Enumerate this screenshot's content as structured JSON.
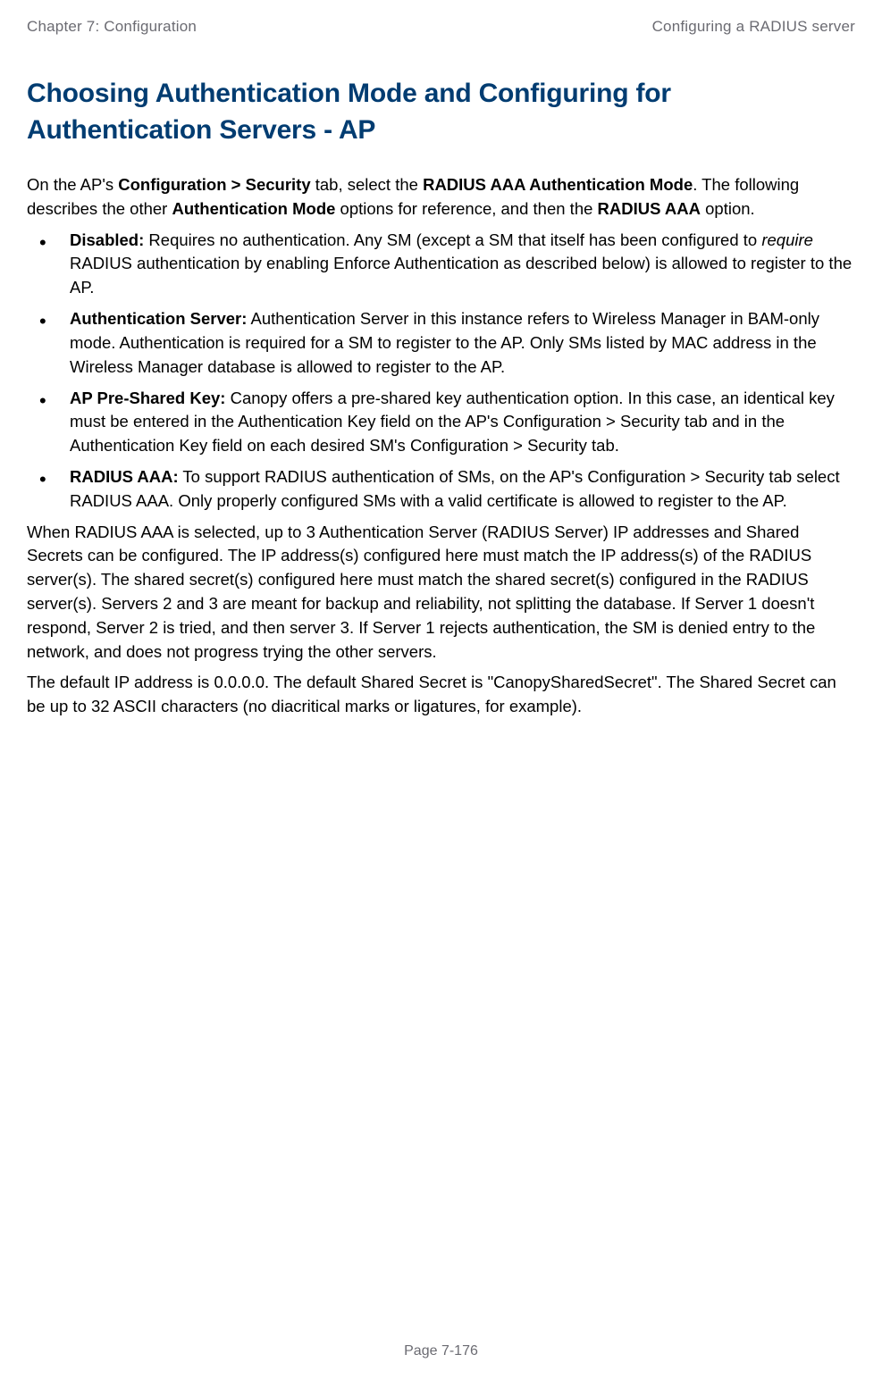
{
  "header": {
    "left": "Chapter 7:  Configuration",
    "right": "Configuring a RADIUS server"
  },
  "heading": "Choosing Authentication Mode and Configuring for Authentication Servers - AP",
  "intro": {
    "p1a": "On the AP's ",
    "p1b": "Configuration > Security",
    "p1c": " tab, select the ",
    "p1d": "RADIUS AAA Authentication Mode",
    "p1e": ". The following describes the other ",
    "p1f": "Authentication Mode",
    "p1g": " options for reference, and then the ",
    "p1h": "RADIUS AAA",
    "p1i": " option."
  },
  "bullets": {
    "b1_label": "Disabled:",
    "b1_texta": " Requires no authentication. Any SM (except a SM that itself has been configured to ",
    "b1_italic": "require",
    "b1_textb": " RADIUS authentication by enabling Enforce Authentication as described below) is allowed to register to the AP.",
    "b2_label": "Authentication Server:",
    "b2_text": " Authentication Server in this instance refers to Wireless Manager in BAM-only mode. Authentication is required for a SM to register to the AP. Only SMs listed by MAC address in the Wireless Manager database is allowed to register to the AP.",
    "b3_label": "AP Pre-Shared Key:",
    "b3_text": " Canopy offers a pre-shared key authentication option. In this case, an identical key must be entered in the Authentication Key field on the AP's Configuration > Security tab and in the Authentication Key field on each desired SM's Configuration > Security tab.",
    "b4_label": "RADIUS AAA:",
    "b4_text": " To support RADIUS authentication of SMs, on the AP's Configuration > Security tab select RADIUS AAA. Only properly configured SMs with a valid certificate is allowed to register to the AP."
  },
  "para2": "When RADIUS AAA is selected, up to 3 Authentication Server (RADIUS Server) IP addresses and Shared Secrets can be configured. The IP address(s) configured here must match the IP address(s) of the RADIUS server(s). The shared secret(s) configured here must match the shared secret(s) configured in the RADIUS server(s). Servers 2 and 3 are meant for backup and reliability, not splitting the database. If Server 1 doesn't respond, Server 2 is tried, and then server 3. If Server 1 rejects authentication, the SM is denied entry to the network, and does not progress trying the other servers.",
  "para3": "The default IP address is 0.0.0.0. The default Shared Secret is \"CanopySharedSecret\". The Shared Secret can be up to 32 ASCII characters (no diacritical marks or ligatures, for example).",
  "footer": "Page 7-176"
}
